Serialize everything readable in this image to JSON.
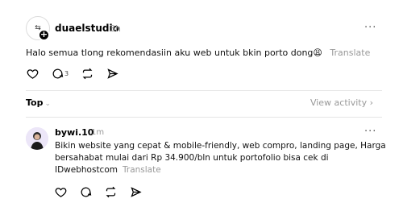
{
  "post": {
    "avatar_text": "⇆",
    "username": "duaelstudio",
    "timestamp": "3h",
    "more_label": "···",
    "text": "Halo semua tlong rekomendasiin aku web untuk bkin porto dong😩",
    "translate_label": "Translate",
    "reply_count": "3",
    "icons": [
      "heart-icon",
      "comment-icon",
      "repost-icon",
      "share-icon"
    ]
  },
  "sort": {
    "label": "Top",
    "chevron": "⌄",
    "view_activity": "View activity ›"
  },
  "reply": {
    "username": "bywi.10",
    "timestamp": "1m",
    "more_label": "···",
    "lines": [
      "Bikin website yang cepat & mobile-friendly, web compro, landing page, Harga",
      "bersahabat mulai dari Rp 34.900/bln untuk portofolio bisa cek di",
      "IDwebhostcom"
    ],
    "translate_label": "Translate",
    "icons": [
      "heart-icon",
      "comment-icon",
      "repost-icon",
      "share-icon"
    ]
  },
  "colors": {
    "text": "#000000",
    "muted": "#999999",
    "divider": "#e5e5e5"
  }
}
